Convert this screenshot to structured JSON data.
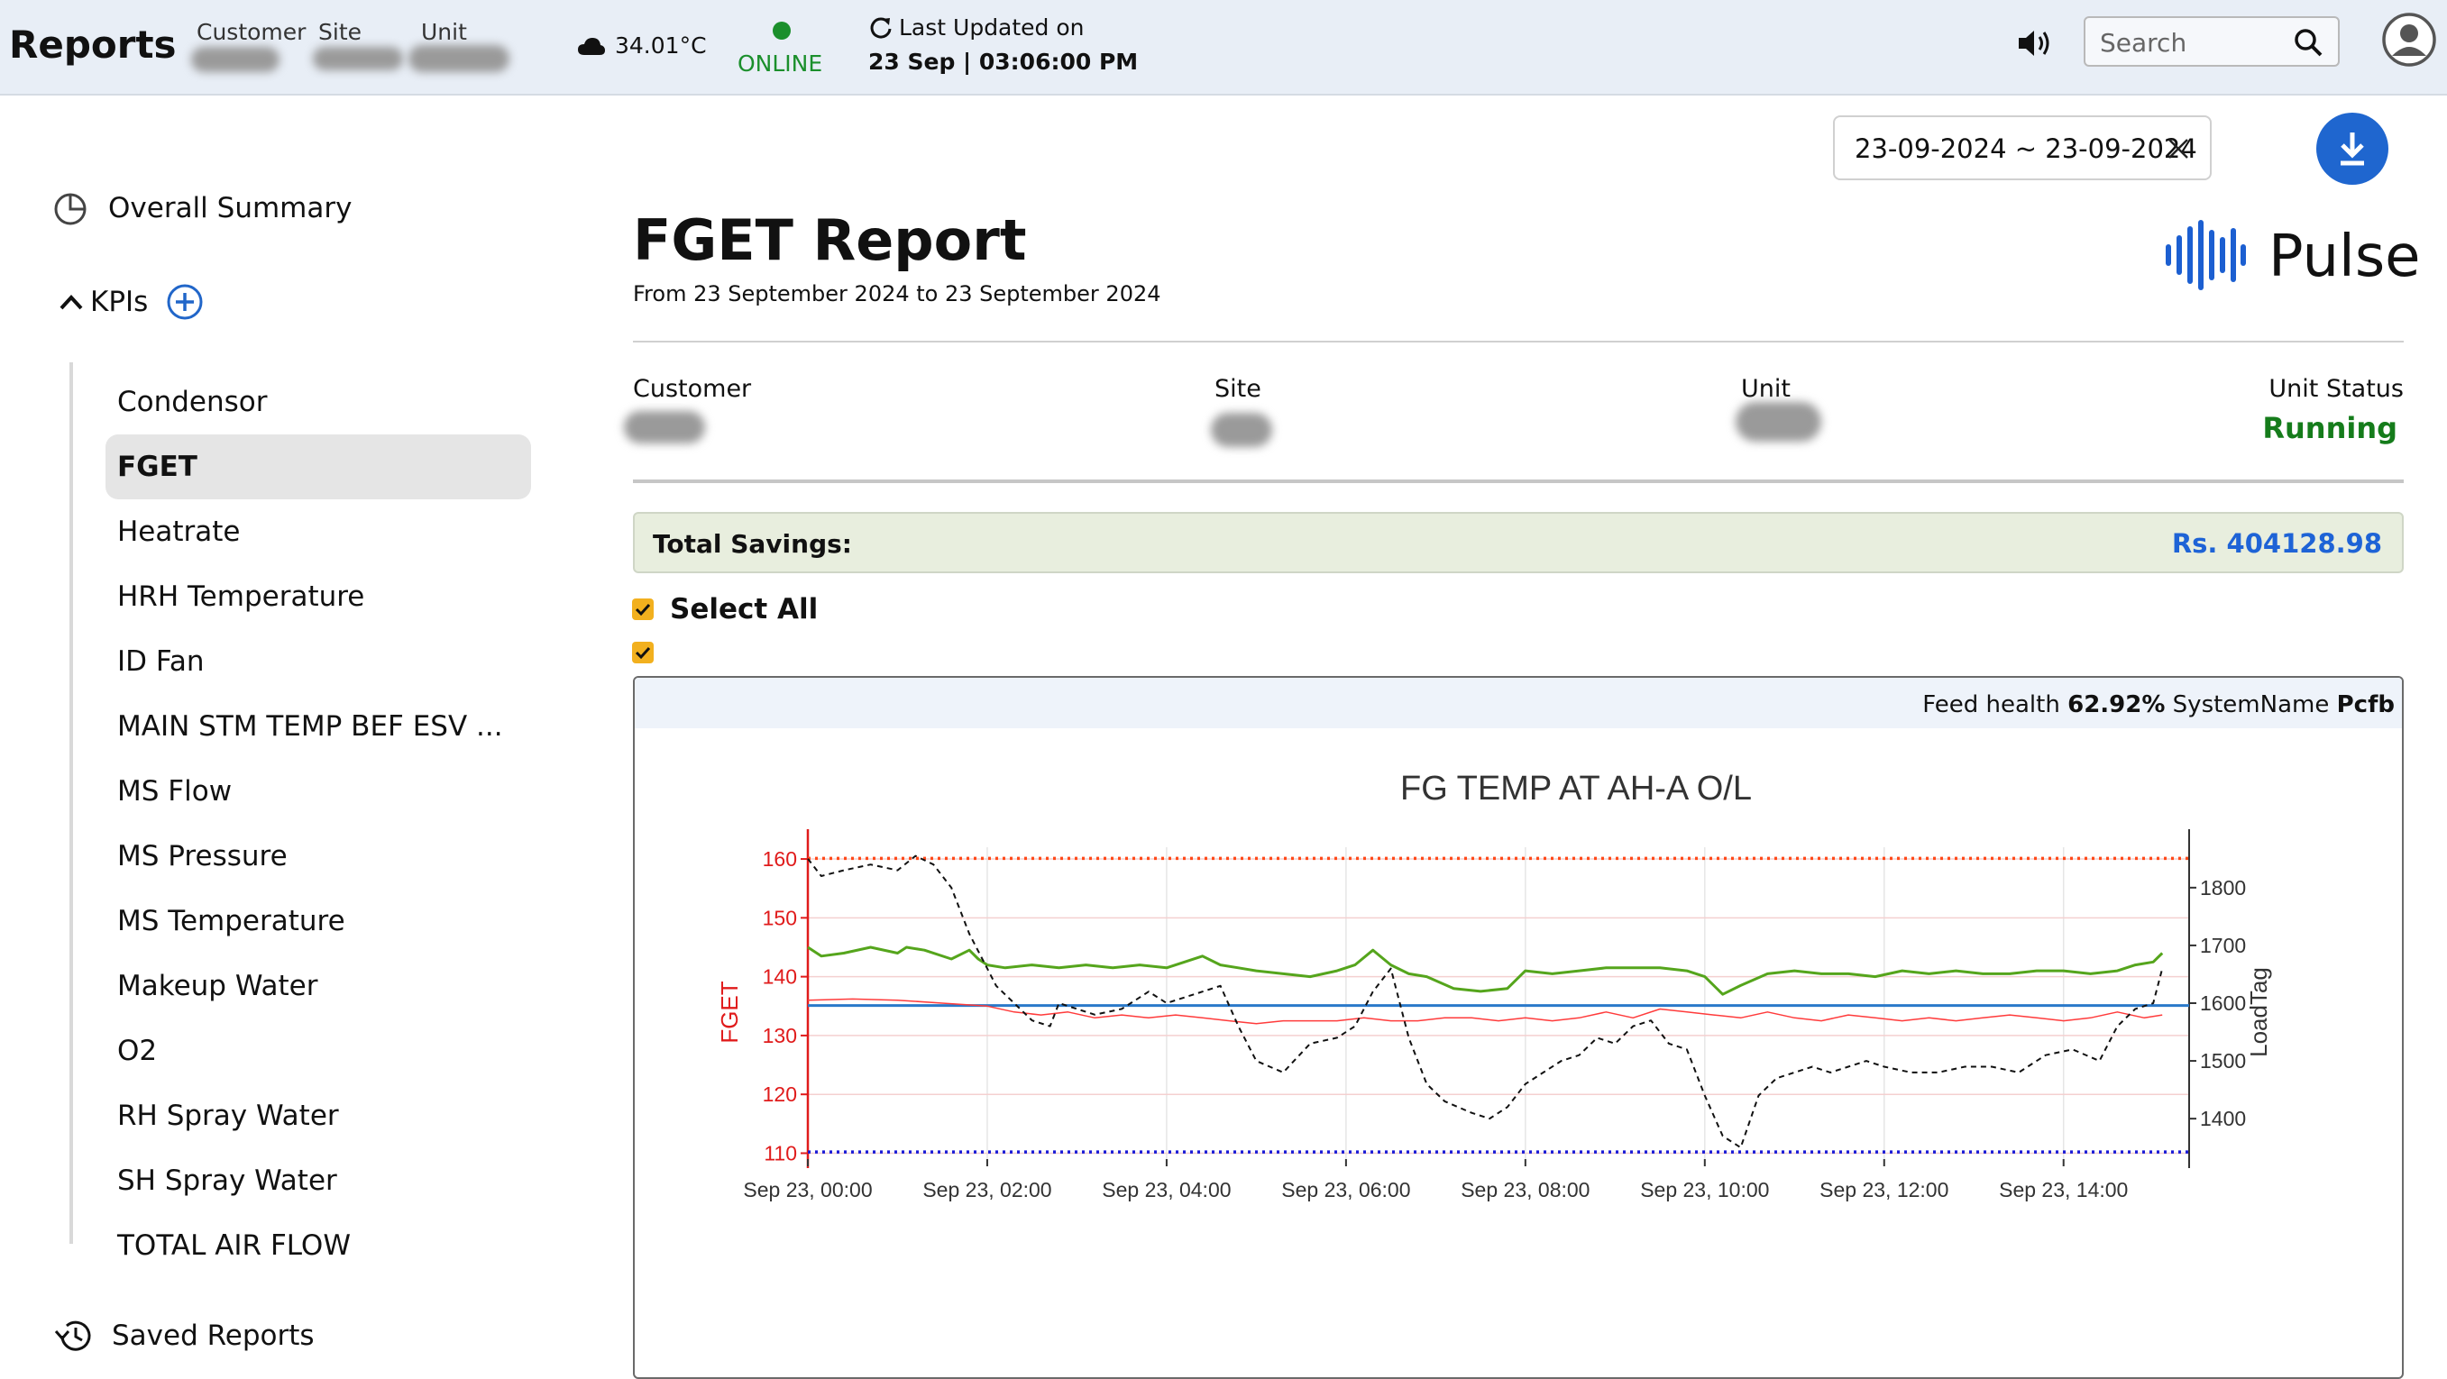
{
  "header": {
    "title": "Reports",
    "customer_label": "Customer",
    "site_label": "Site",
    "unit_label": "Unit",
    "temperature": "34.01°C",
    "status": "ONLINE",
    "last_updated_label": "Last Updated on",
    "last_updated_value": "23 Sep | 03:06:00 PM",
    "search_placeholder": "Search"
  },
  "sidebar": {
    "overall_summary": "Overall Summary",
    "kpis_label": "KPIs",
    "items": [
      {
        "label": "Condensor"
      },
      {
        "label": "FGET"
      },
      {
        "label": "Heatrate"
      },
      {
        "label": "HRH Temperature"
      },
      {
        "label": "ID Fan"
      },
      {
        "label": "MAIN STM TEMP BEF ESV ..."
      },
      {
        "label": "MS Flow"
      },
      {
        "label": "MS Pressure"
      },
      {
        "label": "MS Temperature"
      },
      {
        "label": "Makeup Water"
      },
      {
        "label": "O2"
      },
      {
        "label": "RH Spray Water"
      },
      {
        "label": "SH Spray Water"
      },
      {
        "label": "TOTAL AIR FLOW"
      }
    ],
    "active_item": "FGET",
    "saved_reports": "Saved Reports"
  },
  "toolbar": {
    "date_range": "23-09-2024 ~ 23-09-2024"
  },
  "report": {
    "title": "FGET Report",
    "subtitle": "From 23 September 2024 to 23 September 2024",
    "logo_text": "Pulse",
    "customer_label": "Customer",
    "site_label": "Site",
    "unit_label": "Unit",
    "unit_status_label": "Unit Status",
    "unit_status_value": "Running",
    "total_savings_label": "Total Savings:",
    "total_savings_value": "Rs. 404128.98",
    "select_all_label": "Select All"
  },
  "chart_card": {
    "feed_health_label": "Feed health",
    "feed_health_value": "62.92%",
    "system_name_label": "SystemName",
    "system_name_value": "Pcfb"
  },
  "colors": {
    "accent_blue": "#1f66cf",
    "online_green": "#1b8f2c",
    "running_green": "#157c1b",
    "savings_blue": "#1e63d6",
    "checkbox_yellow": "#f2b01e"
  },
  "chart_data": {
    "type": "line",
    "title": "FG TEMP AT AH-A O/L",
    "ylabel": "FGET",
    "y2label": "LoadTag",
    "ylim": [
      109,
      162
    ],
    "y2lim": [
      1330,
      1870
    ],
    "yticks": [
      110,
      120,
      130,
      140,
      150,
      160
    ],
    "y2ticks": [
      1400,
      1500,
      1600,
      1700,
      1800
    ],
    "xlim": [
      0,
      15.4
    ],
    "xticks": [
      "Sep 23, 00:00",
      "Sep 23, 02:00",
      "Sep 23, 04:00",
      "Sep 23, 06:00",
      "Sep 23, 08:00",
      "Sep 23, 10:00",
      "Sep 23, 12:00",
      "Sep 23, 14:00"
    ],
    "xtick_hours": [
      0,
      2,
      4,
      6,
      8,
      10,
      12,
      14
    ],
    "reference_lines": [
      {
        "value": 160.1,
        "axis": "left",
        "color": "#ff4a1a",
        "style": "dotted"
      },
      {
        "value": 110.2,
        "axis": "left",
        "color": "#1a1ad6",
        "style": "dotted"
      },
      {
        "value": 135.1,
        "axis": "left",
        "color": "#2a79c9",
        "style": "solid"
      }
    ],
    "series": [
      {
        "color": "#55a51c",
        "axis": "left",
        "style": "solid",
        "width": 3,
        "x": [
          0,
          0.15,
          0.4,
          0.7,
          1.0,
          1.1,
          1.3,
          1.6,
          1.8,
          1.9,
          2.0,
          2.2,
          2.5,
          2.8,
          3.1,
          3.4,
          3.7,
          4.0,
          4.2,
          4.4,
          4.6,
          4.8,
          5.0,
          5.3,
          5.6,
          5.9,
          6.1,
          6.3,
          6.5,
          6.7,
          6.9,
          7.2,
          7.5,
          7.8,
          8.0,
          8.3,
          8.6,
          8.9,
          9.2,
          9.5,
          9.8,
          10.0,
          10.2,
          10.4,
          10.7,
          11.0,
          11.3,
          11.6,
          11.9,
          12.2,
          12.5,
          12.8,
          13.1,
          13.4,
          13.7,
          14.0,
          14.3,
          14.6,
          14.8,
          15.0,
          15.1
        ],
        "y": [
          145,
          143.5,
          144,
          145,
          144,
          145,
          144.5,
          143,
          144.5,
          143,
          142,
          141.5,
          142,
          141.5,
          142,
          141.5,
          142,
          141.5,
          142.5,
          143.5,
          142,
          141.5,
          141,
          140.5,
          140,
          141,
          142,
          144.5,
          142,
          140.5,
          140,
          138,
          137.5,
          138,
          141,
          140.5,
          141,
          141.5,
          141.5,
          141.5,
          141,
          140,
          137,
          138.5,
          140.5,
          141,
          140.5,
          140.5,
          140,
          141,
          140.5,
          141,
          140.5,
          140.5,
          141,
          141,
          140.5,
          141,
          142,
          142.5,
          144
        ]
      },
      {
        "color": "#ff3b3b",
        "axis": "left",
        "style": "solid",
        "width": 1.5,
        "x": [
          0,
          0.5,
          1.0,
          1.5,
          2.0,
          2.3,
          2.6,
          2.9,
          3.2,
          3.5,
          3.8,
          4.1,
          4.4,
          4.7,
          5.0,
          5.3,
          5.6,
          5.9,
          6.2,
          6.5,
          6.8,
          7.1,
          7.4,
          7.7,
          8.0,
          8.3,
          8.6,
          8.9,
          9.2,
          9.5,
          9.8,
          10.1,
          10.4,
          10.7,
          11.0,
          11.3,
          11.6,
          11.9,
          12.2,
          12.5,
          12.8,
          13.1,
          13.4,
          13.7,
          14.0,
          14.3,
          14.6,
          14.9,
          15.1
        ],
        "y": [
          136,
          136.2,
          136,
          135.5,
          135,
          134,
          133.5,
          134,
          133,
          133.5,
          133,
          133.5,
          133,
          132.5,
          132,
          132.5,
          132.5,
          132.5,
          133,
          132.5,
          132.5,
          133,
          133,
          132.5,
          133,
          132.5,
          133,
          134,
          133,
          134.5,
          134,
          133.5,
          133,
          134,
          133,
          132.5,
          133.5,
          133,
          132.5,
          133,
          132.5,
          133,
          133.5,
          133,
          132.5,
          133,
          134,
          133,
          133.5
        ]
      },
      {
        "color": "#111111",
        "axis": "right",
        "style": "dashed",
        "width": 2,
        "x": [
          0,
          0.15,
          0.4,
          0.7,
          1.0,
          1.2,
          1.4,
          1.6,
          1.8,
          1.9,
          2.0,
          2.1,
          2.3,
          2.5,
          2.7,
          2.8,
          3.0,
          3.2,
          3.5,
          3.8,
          4.0,
          4.2,
          4.4,
          4.6,
          4.8,
          5.0,
          5.3,
          5.6,
          5.9,
          6.1,
          6.3,
          6.5,
          6.7,
          6.9,
          7.1,
          7.4,
          7.6,
          7.8,
          8.0,
          8.2,
          8.4,
          8.6,
          8.8,
          9.0,
          9.2,
          9.4,
          9.6,
          9.8,
          10.0,
          10.2,
          10.4,
          10.6,
          10.8,
          11.0,
          11.2,
          11.4,
          11.6,
          11.8,
          12.0,
          12.3,
          12.6,
          12.9,
          13.2,
          13.5,
          13.8,
          14.1,
          14.4,
          14.6,
          14.8,
          15.0,
          15.1
        ],
        "y": [
          1850,
          1820,
          1830,
          1840,
          1830,
          1855,
          1840,
          1800,
          1720,
          1690,
          1660,
          1630,
          1600,
          1570,
          1560,
          1600,
          1590,
          1580,
          1590,
          1620,
          1600,
          1610,
          1620,
          1630,
          1560,
          1500,
          1480,
          1530,
          1540,
          1560,
          1620,
          1660,
          1540,
          1460,
          1430,
          1410,
          1400,
          1420,
          1460,
          1480,
          1500,
          1510,
          1540,
          1530,
          1560,
          1570,
          1530,
          1520,
          1440,
          1370,
          1350,
          1440,
          1470,
          1480,
          1490,
          1480,
          1490,
          1500,
          1490,
          1480,
          1480,
          1490,
          1490,
          1480,
          1510,
          1520,
          1500,
          1560,
          1590,
          1600,
          1660
        ]
      }
    ]
  }
}
